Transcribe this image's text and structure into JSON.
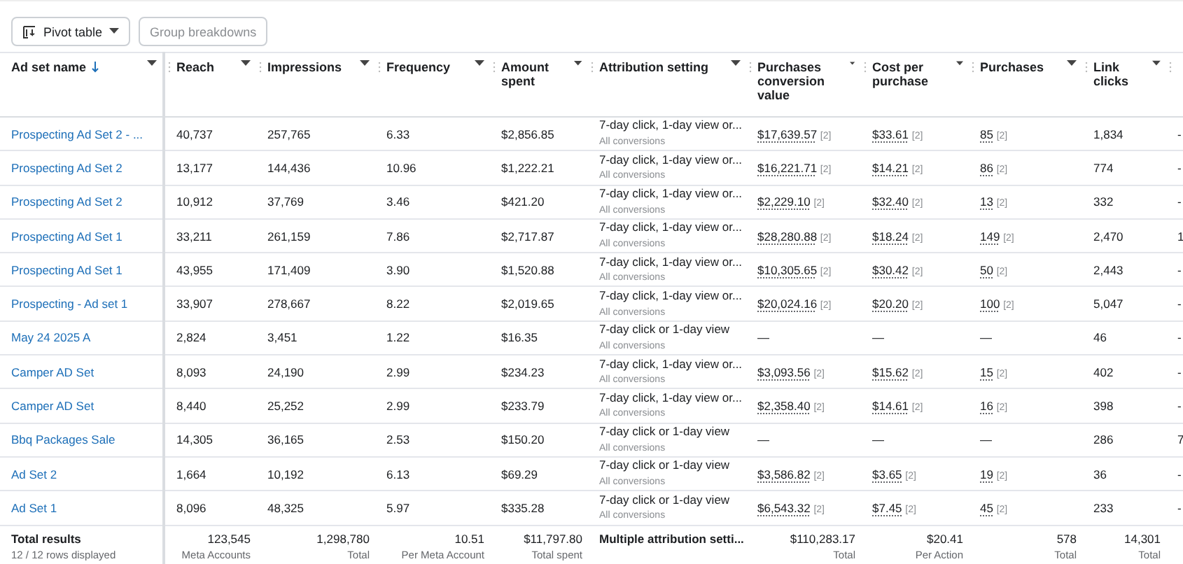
{
  "toolbar": {
    "pivot_button": "Pivot table",
    "group_button": "Group breakdowns"
  },
  "table": {
    "columns": [
      {
        "label": "Ad set name",
        "sorted": true
      },
      {
        "label": "Reach",
        "sorted": false
      },
      {
        "label": "Impressions",
        "sorted": false
      },
      {
        "label": "Frequency",
        "sorted": false
      },
      {
        "label": "Amount spent",
        "sorted": false
      },
      {
        "label": "Attribution setting",
        "sorted": false
      },
      {
        "label": "Purchases conversion value",
        "sorted": false
      },
      {
        "label": "Cost per purchase",
        "sorted": false
      },
      {
        "label": "Purchases",
        "sorted": false
      },
      {
        "label": "Link clicks",
        "sorted": false
      }
    ],
    "rows": [
      {
        "name": "Prospecting Ad Set 2 - ...",
        "reach": "40,737",
        "impressions": "257,765",
        "frequency": "6.33",
        "amount": "$2,856.85",
        "attribution": "7-day click, 1-day view or...",
        "attribution_note": "All conversions",
        "value": {
          "text": "$17,639.57",
          "note": "[2]"
        },
        "cost": {
          "text": "$33.61",
          "note": "[2]"
        },
        "purchases": {
          "text": "85",
          "note": "[2]"
        },
        "clicks": "1,834",
        "column_11": "-"
      },
      {
        "name": "Prospecting Ad Set 2",
        "reach": "13,177",
        "impressions": "144,436",
        "frequency": "10.96",
        "amount": "$1,222.21",
        "attribution": "7-day click, 1-day view or...",
        "attribution_note": "All conversions",
        "value": {
          "text": "$16,221.71",
          "note": "[2]"
        },
        "cost": {
          "text": "$14.21",
          "note": "[2]"
        },
        "purchases": {
          "text": "86",
          "note": "[2]"
        },
        "clicks": "774",
        "column_11": "-"
      },
      {
        "name": "Prospecting Ad Set 2",
        "reach": "10,912",
        "impressions": "37,769",
        "frequency": "3.46",
        "amount": "$421.20",
        "attribution": "7-day click, 1-day view or...",
        "attribution_note": "All conversions",
        "value": {
          "text": "$2,229.10",
          "note": "[2]"
        },
        "cost": {
          "text": "$32.40",
          "note": "[2]"
        },
        "purchases": {
          "text": "13",
          "note": "[2]"
        },
        "clicks": "332",
        "column_11": "-"
      },
      {
        "name": "Prospecting Ad Set 1",
        "reach": "33,211",
        "impressions": "261,159",
        "frequency": "7.86",
        "amount": "$2,717.87",
        "attribution": "7-day click, 1-day view or...",
        "attribution_note": "All conversions",
        "value": {
          "text": "$28,280.88",
          "note": "[2]"
        },
        "cost": {
          "text": "$18.24",
          "note": "[2]"
        },
        "purchases": {
          "text": "149",
          "note": "[2]"
        },
        "clicks": "2,470",
        "column_11": "1"
      },
      {
        "name": "Prospecting Ad Set 1",
        "reach": "43,955",
        "impressions": "171,409",
        "frequency": "3.90",
        "amount": "$1,520.88",
        "attribution": "7-day click, 1-day view or...",
        "attribution_note": "All conversions",
        "value": {
          "text": "$10,305.65",
          "note": "[2]"
        },
        "cost": {
          "text": "$30.42",
          "note": "[2]"
        },
        "purchases": {
          "text": "50",
          "note": "[2]"
        },
        "clicks": "2,443",
        "column_11": "-"
      },
      {
        "name": "Prospecting - Ad set 1",
        "reach": "33,907",
        "impressions": "278,667",
        "frequency": "8.22",
        "amount": "$2,019.65",
        "attribution": "7-day click, 1-day view or...",
        "attribution_note": "All conversions",
        "value": {
          "text": "$20,024.16",
          "note": "[2]"
        },
        "cost": {
          "text": "$20.20",
          "note": "[2]"
        },
        "purchases": {
          "text": "100",
          "note": "[2]"
        },
        "clicks": "5,047",
        "column_11": "-"
      },
      {
        "name": "May 24 2025 A",
        "reach": "2,824",
        "impressions": "3,451",
        "frequency": "1.22",
        "amount": "$16.35",
        "attribution": "7-day click or 1-day view",
        "attribution_note": "All conversions",
        "value": {
          "text": "—"
        },
        "cost": {
          "text": "—"
        },
        "purchases": {
          "text": "—"
        },
        "clicks": "46",
        "column_11": "-"
      },
      {
        "name": "Camper AD Set",
        "reach": "8,093",
        "impressions": "24,190",
        "frequency": "2.99",
        "amount": "$234.23",
        "attribution": "7-day click, 1-day view or...",
        "attribution_note": "All conversions",
        "value": {
          "text": "$3,093.56",
          "note": "[2]"
        },
        "cost": {
          "text": "$15.62",
          "note": "[2]"
        },
        "purchases": {
          "text": "15",
          "note": "[2]"
        },
        "clicks": "402",
        "column_11": "-"
      },
      {
        "name": "Camper AD Set",
        "reach": "8,440",
        "impressions": "25,252",
        "frequency": "2.99",
        "amount": "$233.79",
        "attribution": "7-day click, 1-day view or...",
        "attribution_note": "All conversions",
        "value": {
          "text": "$2,358.40",
          "note": "[2]"
        },
        "cost": {
          "text": "$14.61",
          "note": "[2]"
        },
        "purchases": {
          "text": "16",
          "note": "[2]"
        },
        "clicks": "398",
        "column_11": "-"
      },
      {
        "name": "Bbq Packages Sale",
        "reach": "14,305",
        "impressions": "36,165",
        "frequency": "2.53",
        "amount": "$150.20",
        "attribution": "7-day click or 1-day view",
        "attribution_note": "All conversions",
        "value": {
          "text": "—"
        },
        "cost": {
          "text": "—"
        },
        "purchases": {
          "text": "—"
        },
        "clicks": "286",
        "column_11": "7"
      },
      {
        "name": "Ad Set 2",
        "reach": "1,664",
        "impressions": "10,192",
        "frequency": "6.13",
        "amount": "$69.29",
        "attribution": "7-day click or 1-day view",
        "attribution_note": "All conversions",
        "value": {
          "text": "$3,586.82",
          "note": "[2]"
        },
        "cost": {
          "text": "$3.65",
          "note": "[2]"
        },
        "purchases": {
          "text": "19",
          "note": "[2]"
        },
        "clicks": "36",
        "column_11": "-"
      },
      {
        "name": "Ad Set 1",
        "reach": "8,096",
        "impressions": "48,325",
        "frequency": "5.97",
        "amount": "$335.28",
        "attribution": "7-day click or 1-day view",
        "attribution_note": "All conversions",
        "value": {
          "text": "$6,543.32",
          "note": "[2]"
        },
        "cost": {
          "text": "$7.45",
          "note": "[2]"
        },
        "purchases": {
          "text": "45",
          "note": "[2]"
        },
        "clicks": "233",
        "column_11": "-"
      }
    ],
    "totals": {
      "label": "Total results",
      "rows_displayed": "12 / 12 rows displayed",
      "cells": [
        {
          "value": "123,545",
          "caption": "Meta Accounts"
        },
        {
          "value": "1,298,780",
          "caption": "Total"
        },
        {
          "value": "10.51",
          "caption": "Per Meta Account"
        },
        {
          "value": "$11,797.80",
          "caption": "Total spent"
        },
        {
          "value": "Multiple attribution setti...",
          "kind": "attribution"
        },
        {
          "value": "$110,283.17",
          "caption": "Total"
        },
        {
          "value": "$20.41",
          "caption": "Per Action"
        },
        {
          "value": "578",
          "caption": "Total"
        },
        {
          "value": "14,301",
          "caption": "Total"
        }
      ]
    }
  }
}
